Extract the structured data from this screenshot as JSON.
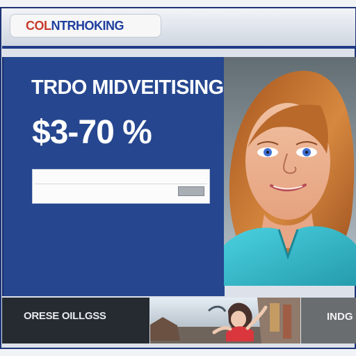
{
  "header": {
    "logo_part_a": "COL",
    "logo_part_b": "NTRHOKING",
    "top_link": ""
  },
  "hero": {
    "headline": "TRDO MIDVEITISING",
    "subline": "",
    "price": "$3-70 %",
    "mini_line": "",
    "field_1": "",
    "field_2": "",
    "button": "",
    "body_copy": ""
  },
  "bottom": {
    "left_title": "ORESE OILLGSS",
    "left_subtitle": "",
    "right_title": "INDG"
  },
  "colors": {
    "brand_blue": "#26478f",
    "accent_red": "#c83a2c",
    "nav_blue": "#1f3a86"
  }
}
